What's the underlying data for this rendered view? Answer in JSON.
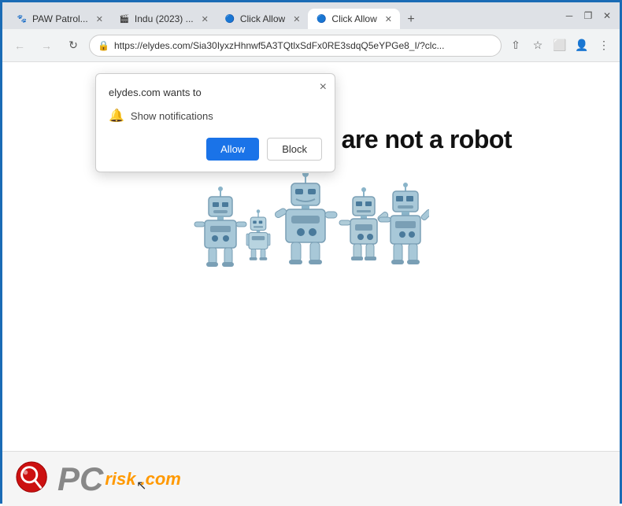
{
  "window": {
    "border_color": "#1a6bb5"
  },
  "titlebar": {
    "tabs": [
      {
        "id": "tab-1",
        "label": "PAW Patrol...",
        "favicon": "🐾",
        "active": false,
        "closeable": true
      },
      {
        "id": "tab-2",
        "label": "Indu (2023) ...",
        "favicon": "🎬",
        "active": false,
        "closeable": true
      },
      {
        "id": "tab-3",
        "label": "Click Allow",
        "favicon": "🔵",
        "active": false,
        "closeable": true
      },
      {
        "id": "tab-4",
        "label": "Click Allow",
        "favicon": "🔵",
        "active": true,
        "closeable": true
      }
    ],
    "new_tab_label": "+",
    "minimize_label": "─",
    "restore_label": "❐",
    "close_label": "✕"
  },
  "navbar": {
    "back_label": "←",
    "forward_label": "→",
    "refresh_label": "↻",
    "url": "https://elydes.com/Sia30IyxzHhnwf5A3TQtlxSdFx0RE3sdqQ5eYPGe8_I/?clc...",
    "share_label": "⇧",
    "bookmark_label": "☆",
    "extension_label": "⬜",
    "profile_label": "👤",
    "menu_label": "⋮"
  },
  "popup": {
    "title": "elydes.com wants to",
    "close_label": "×",
    "permission_icon": "🔔",
    "permission_text": "Show notifications",
    "allow_label": "Allow",
    "block_label": "Block"
  },
  "page": {
    "main_text": "Click \"Allow\"   if you are not   a robot"
  },
  "pcrisk": {
    "text_pc": "PC",
    "text_risk": "risk",
    "text_dot_com": ".com"
  }
}
